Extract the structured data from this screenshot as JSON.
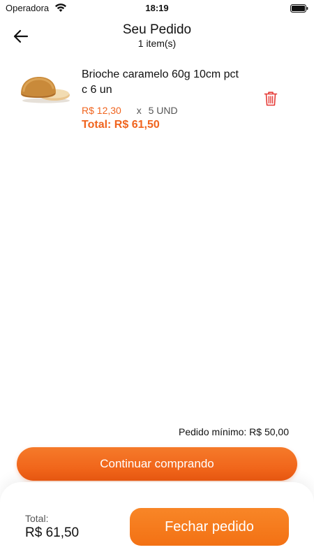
{
  "status_bar": {
    "carrier": "Operadora",
    "time": "18:19",
    "wifi_icon": "wifi-icon",
    "battery_icon": "battery-icon"
  },
  "header": {
    "back_icon": "arrow-left-icon",
    "title": "Seu Pedido",
    "subtitle": "1 item(s)"
  },
  "cart": {
    "items": [
      {
        "name": "Brioche caramelo 60g 10cm pct c 6 un",
        "unit_price": "R$ 12,30",
        "qty_separator": "x",
        "quantity": "5 UND",
        "total": "Total: R$ 61,50",
        "image_icon": "brioche-bun-image",
        "delete_icon": "trash-icon"
      }
    ]
  },
  "min_order": "Pedido mínimo: R$ 50,00",
  "continue_label": "Continuar comprando",
  "footer": {
    "total_label": "Total:",
    "total_value": "R$ 61,50",
    "checkout_label": "Fechar pedido"
  },
  "colors": {
    "accent": "#f0641e",
    "button": "#f57a2a",
    "checkout": "#f37114"
  }
}
